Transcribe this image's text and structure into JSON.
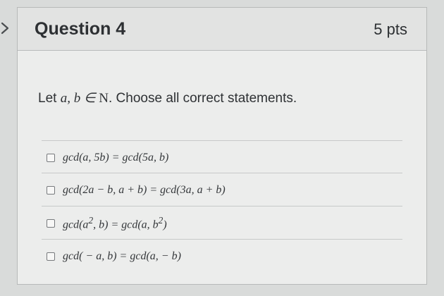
{
  "collapse_icon": "chevron-right-icon",
  "question": {
    "title": "Question 4",
    "points": "5 pts",
    "prompt": {
      "lead": "Let ",
      "math_vars": "a, b ∈ ",
      "math_set": "N",
      "tail": ". Choose all correct statements."
    },
    "options": [
      {
        "checked": false,
        "text_html": "gcd(a, 5b) = gcd(5a, b)"
      },
      {
        "checked": false,
        "text_html": "gcd(2a − b, a + b) = gcd(3a, a + b)"
      },
      {
        "checked": false,
        "text_html": "gcd(a<sup>2</sup>, b) = gcd(a, b<sup>2</sup>)"
      },
      {
        "checked": false,
        "text_html": "gcd( − a, b) = gcd(a,  − b)"
      }
    ]
  }
}
